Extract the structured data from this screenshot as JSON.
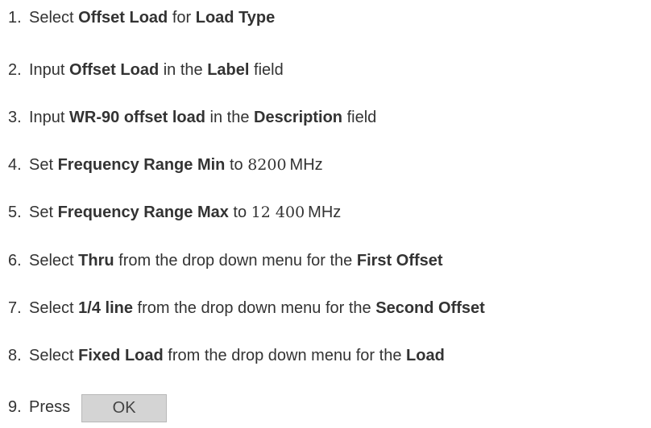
{
  "steps": [
    {
      "num": "1.",
      "t1": "Select ",
      "b1": "Offset Load",
      "t2": " for ",
      "b2": "Load Type"
    },
    {
      "num": "2.",
      "t1": "Input ",
      "b1": "Offset Load",
      "t2": " in the ",
      "b2": "Label",
      "t3": " field"
    },
    {
      "num": "3.",
      "t1": "Input ",
      "b1": "WR-90 offset load",
      "t2": " in the ",
      "b2": "Description",
      "t3": " field"
    },
    {
      "num": "4.",
      "t1": "Set ",
      "b1": "Frequency Range Min",
      "t2": " to ",
      "value": "8200",
      "unit": "MHz"
    },
    {
      "num": "5.",
      "t1": "Set ",
      "b1": "Frequency Range Max",
      "t2": " to ",
      "value": "12 400",
      "unit": "MHz"
    },
    {
      "num": "6.",
      "t1": "Select ",
      "b1": "Thru",
      "t2": " from the drop down menu for the ",
      "b2": "First Offset"
    },
    {
      "num": "7.",
      "t1": "Select ",
      "b1": "1/4 line",
      "t2": " from the drop down menu for the ",
      "b2": "Second Offset"
    },
    {
      "num": "8.",
      "t1": "Select ",
      "b1": "Fixed Load",
      "t2": " from the drop down menu for the ",
      "b2": "Load"
    },
    {
      "num": "9.",
      "t1": "Press",
      "button": "OK"
    }
  ]
}
